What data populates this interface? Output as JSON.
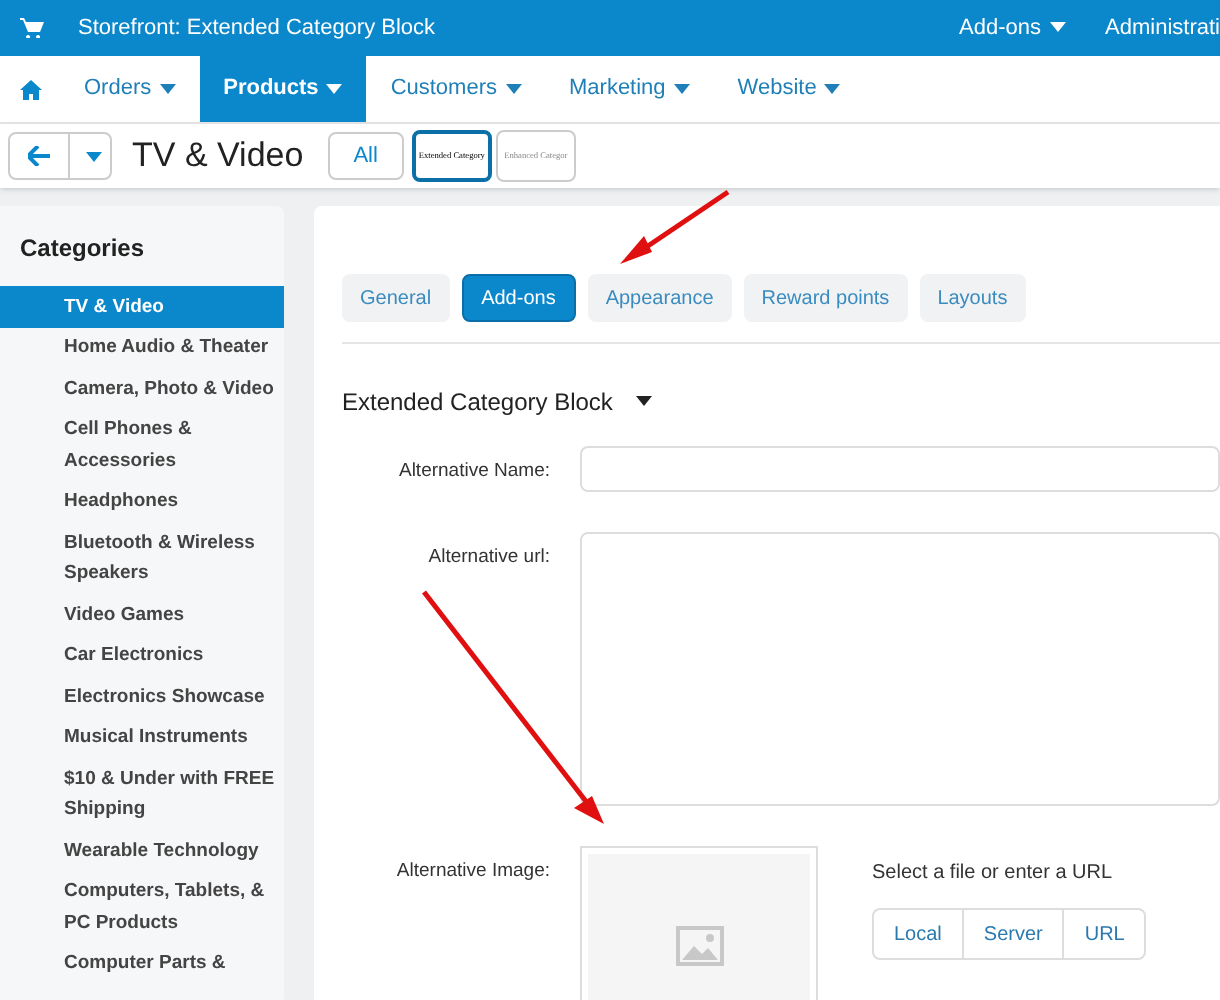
{
  "top_bar": {
    "title": "Storefront: Extended Category Block",
    "menus": [
      {
        "label": "Add-ons",
        "caret": true
      },
      {
        "label": "Administrati",
        "caret": false
      }
    ]
  },
  "nav": {
    "items": [
      {
        "label": "Orders",
        "selected": false
      },
      {
        "label": "Products",
        "selected": true
      },
      {
        "label": "Customers",
        "selected": false
      },
      {
        "label": "Marketing",
        "selected": false
      },
      {
        "label": "Website",
        "selected": false
      }
    ]
  },
  "toolbar": {
    "title": "TV & Video",
    "filters": [
      {
        "label": "All",
        "kind": "text",
        "selected": false
      },
      {
        "label": "Extended Category",
        "kind": "thumb",
        "selected": true
      },
      {
        "label": "Enhanced Categor",
        "kind": "thumb",
        "selected": false
      }
    ]
  },
  "sidebar": {
    "title": "Categories",
    "items": [
      {
        "label": "TV & Video",
        "selected": true
      },
      {
        "label": "Home Audio & Theater",
        "selected": false
      },
      {
        "label": "Camera, Photo & Video",
        "selected": false
      },
      {
        "label": "Cell Phones & Accessories",
        "selected": false
      },
      {
        "label": "Headphones",
        "selected": false
      },
      {
        "label": "Bluetooth & Wireless Speakers",
        "selected": false
      },
      {
        "label": "Video Games",
        "selected": false
      },
      {
        "label": "Car Electronics",
        "selected": false
      },
      {
        "label": "Electronics Showcase",
        "selected": false
      },
      {
        "label": "Musical Instruments",
        "selected": false
      },
      {
        "label": "$10 & Under with FREE Shipping",
        "selected": false
      },
      {
        "label": "Wearable Technology",
        "selected": false
      },
      {
        "label": "Computers, Tablets, & PC Products",
        "selected": false
      },
      {
        "label": "Computer Parts &",
        "selected": false
      }
    ]
  },
  "tabs": [
    {
      "label": "General",
      "selected": false
    },
    {
      "label": "Add-ons",
      "selected": true
    },
    {
      "label": "Appearance",
      "selected": false
    },
    {
      "label": "Reward points",
      "selected": false
    },
    {
      "label": "Layouts",
      "selected": false
    }
  ],
  "section": {
    "title": "Extended Category Block"
  },
  "form": {
    "fields": [
      {
        "label": "Alternative Name:",
        "kind": "input"
      },
      {
        "label": "Alternative url:",
        "kind": "textarea"
      },
      {
        "label": "Alternative Image:",
        "kind": "image",
        "hint": "Select a file or enter a URL",
        "sources": [
          "Local",
          "Server",
          "URL"
        ]
      }
    ]
  }
}
